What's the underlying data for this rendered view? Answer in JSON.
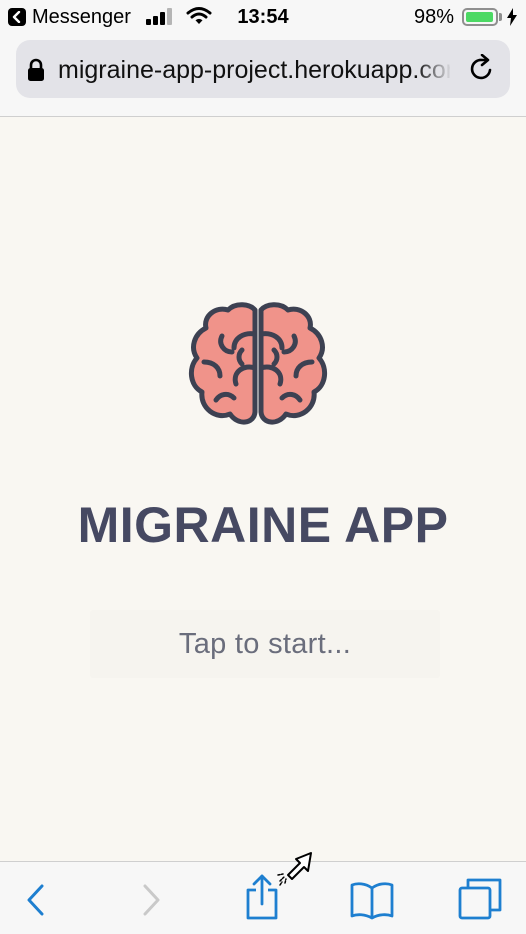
{
  "status_bar": {
    "back_app": "Messenger",
    "time": "13:54",
    "battery_percent": "98%",
    "battery_level": 0.98,
    "icons": [
      "back-chevron-icon",
      "signal-icon",
      "wifi-icon",
      "battery-icon",
      "charging-bolt-icon"
    ]
  },
  "browser": {
    "url": "migraine-app-project.herokuapp.com",
    "icons": [
      "lock-icon",
      "reload-icon"
    ]
  },
  "page": {
    "logo_icon": "brain-icon",
    "title": "MIGRAINE APP",
    "start_label": "Tap to start...",
    "colors": {
      "background": "#f9f7f2",
      "title": "#464962",
      "brain_fill": "#f0938a",
      "brain_outline": "#3d4152",
      "accent_blue": "#1e7fd0"
    }
  },
  "toolbar": {
    "icons": [
      "back-icon",
      "forward-icon",
      "share-icon",
      "bookmarks-icon",
      "tabs-icon"
    ]
  }
}
